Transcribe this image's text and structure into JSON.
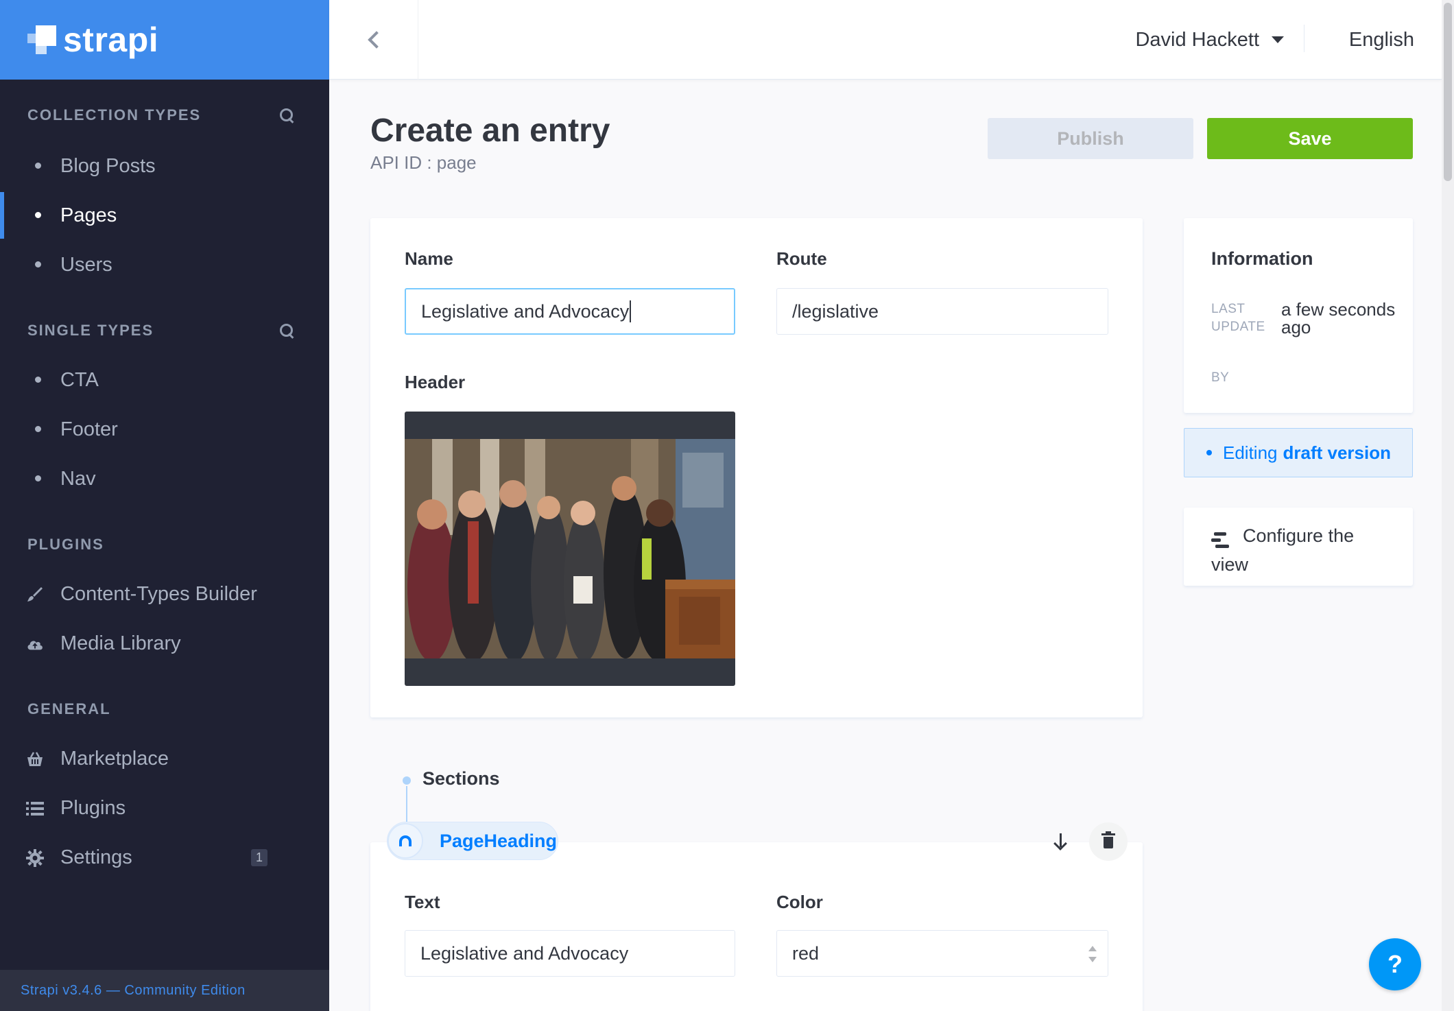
{
  "brand": {
    "name": "strapi"
  },
  "sidebar": {
    "collection_types": {
      "title": "Collection Types",
      "items": [
        {
          "label": "Blog Posts",
          "active": false
        },
        {
          "label": "Pages",
          "active": true
        },
        {
          "label": "Users",
          "active": false
        }
      ]
    },
    "single_types": {
      "title": "Single Types",
      "items": [
        {
          "label": "CTA"
        },
        {
          "label": "Footer"
        },
        {
          "label": "Nav"
        }
      ]
    },
    "plugins": {
      "title": "Plugins",
      "items": [
        {
          "label": "Content-Types Builder",
          "icon": "paintbrush-icon"
        },
        {
          "label": "Media Library",
          "icon": "cloud-upload-icon"
        }
      ]
    },
    "general": {
      "title": "General",
      "items": [
        {
          "label": "Marketplace",
          "icon": "basket-icon"
        },
        {
          "label": "Plugins",
          "icon": "list-icon"
        },
        {
          "label": "Settings",
          "icon": "gear-icon",
          "badge": "1"
        }
      ]
    },
    "footer": "Strapi v3.4.6 — Community Edition"
  },
  "topbar": {
    "user_name": "David Hackett",
    "language": "English"
  },
  "header": {
    "title": "Create an entry",
    "subtitle": "API ID : page",
    "publish_label": "Publish",
    "save_label": "Save"
  },
  "form": {
    "name_label": "Name",
    "name_value": "Legislative and Advocacy",
    "route_label": "Route",
    "route_value": "/legislative",
    "header_label": "Header"
  },
  "info": {
    "title": "Information",
    "last_update_key_1": "Last",
    "last_update_key_2": "Update",
    "last_update_value": "a few seconds ago",
    "by_key": "By",
    "draft_prefix": "Editing",
    "draft_strong": "draft version",
    "configure_label": "Configure the view"
  },
  "sections": {
    "title": "Sections",
    "component_name": "PageHeading",
    "text_label": "Text",
    "text_value": "Legislative and Advocacy",
    "color_label": "Color",
    "color_value": "red"
  },
  "colors": {
    "brand_blue": "#3f8bec",
    "sidebar_bg": "#2e3141",
    "save_green": "#6dbb1a",
    "link_blue": "#007eff"
  },
  "help_label": "?"
}
